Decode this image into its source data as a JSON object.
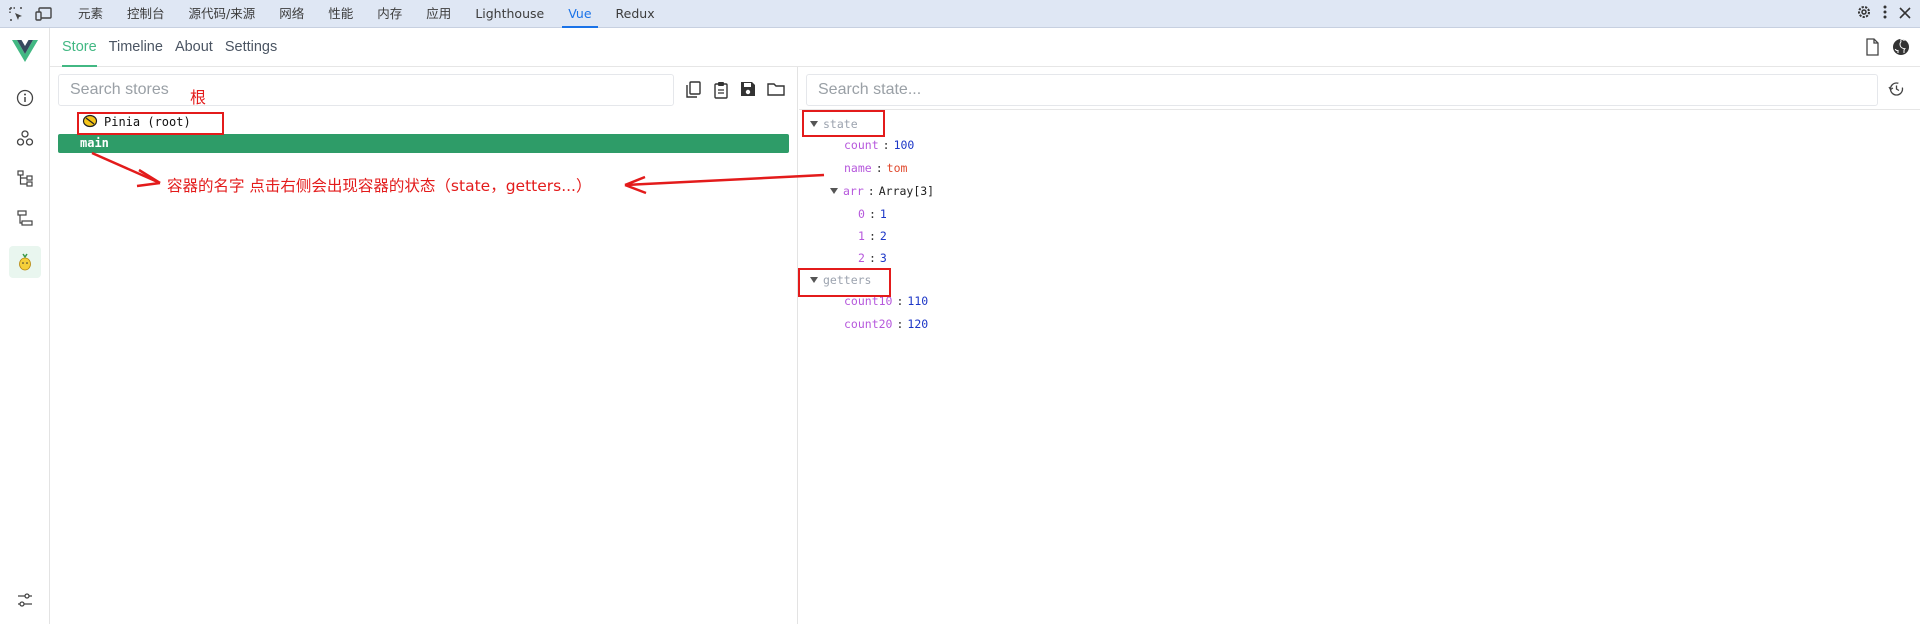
{
  "devtools": {
    "tabs": [
      "元素",
      "控制台",
      "源代码/来源",
      "网络",
      "性能",
      "内存",
      "应用",
      "Lighthouse",
      "Vue",
      "Redux"
    ],
    "active_tab": "Vue"
  },
  "vue_nav": {
    "tabs": [
      "Store",
      "Timeline",
      "About",
      "Settings"
    ],
    "active": "Store"
  },
  "rail": {
    "items": [
      "info-icon",
      "components-icon",
      "tree-icon",
      "timeline-icon",
      "pinia-icon"
    ],
    "bottom": "settings-sliders-icon",
    "accent": "#42b883"
  },
  "stores": {
    "search_placeholder": "Search stores",
    "root_label": "Pinia (root)",
    "selected_store": "main",
    "selected_color": "#2e9c68"
  },
  "state_panel": {
    "search_placeholder": "Search state...",
    "state_label": "state",
    "getters_label": "getters",
    "state": [
      {
        "key": "count",
        "value": "100",
        "type": "num"
      },
      {
        "key": "name",
        "value": "tom",
        "type": "str"
      },
      {
        "key": "arr",
        "value": "Array[3]",
        "type": "plain"
      }
    ],
    "arr_items": [
      {
        "key": "0",
        "value": "1"
      },
      {
        "key": "1",
        "value": "2"
      },
      {
        "key": "2",
        "value": "3"
      }
    ],
    "getters": [
      {
        "key": "count10",
        "value": "110"
      },
      {
        "key": "count20",
        "value": "120"
      }
    ]
  },
  "annotations": {
    "root_note": "根",
    "store_note": "容器的名字 点击右侧会出现容器的状态（state，getters...）",
    "color": "#e31b1b"
  }
}
